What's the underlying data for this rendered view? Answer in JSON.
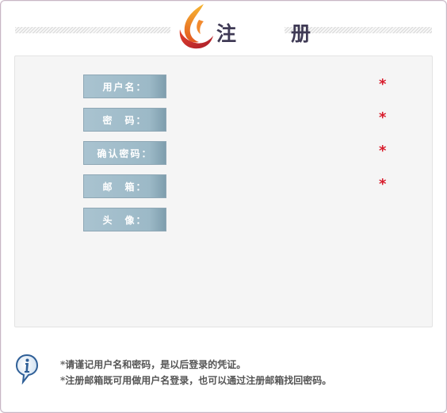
{
  "header": {
    "title": "注　册"
  },
  "form": {
    "fields": [
      {
        "label": "用户名：",
        "required": true,
        "value": ""
      },
      {
        "label": "密　码：",
        "required": true,
        "value": ""
      },
      {
        "label": "确认密码：",
        "required": true,
        "value": ""
      },
      {
        "label": "邮　箱：",
        "required": true,
        "value": ""
      },
      {
        "label": "头　像：",
        "required": false,
        "value": ""
      }
    ],
    "required_mark": "*"
  },
  "notes": {
    "line1": "*请谨记用户名和密码，是以后登录的凭证。",
    "line2": "*注册邮箱既可用做用户名登录，也可以通过注册邮箱找回密码。"
  },
  "colors": {
    "label_bg": "#9cb9c7",
    "required": "#d81b2b",
    "title": "#3f3a55"
  },
  "icons": {
    "logo": "flame-logo-icon",
    "info": "info-bubble-icon"
  }
}
